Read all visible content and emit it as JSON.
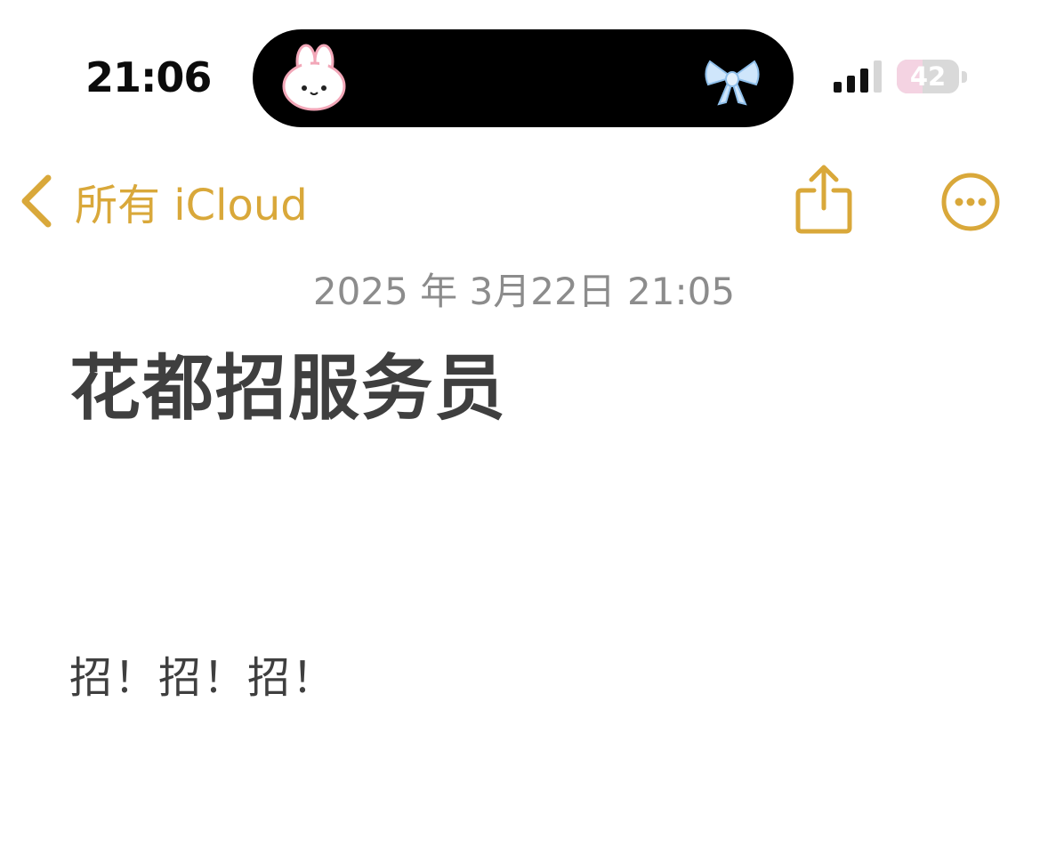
{
  "status_bar": {
    "time": "21:06",
    "battery_level": "42",
    "battery_fraction": 0.42,
    "signal_bars_active": 3,
    "signal_bars_total": 4,
    "island_left_icon": "bunny-sticker-icon",
    "island_right_icon": "blue-bow-icon"
  },
  "nav": {
    "back_label": "所有 iCloud",
    "share_icon": "share-icon",
    "more_icon": "ellipsis-circle-icon",
    "accent_color": "#d9a83a"
  },
  "note": {
    "date": "2025 年 3月22日 21:05",
    "title": "花都招服务员",
    "body": "招！招！招！"
  }
}
